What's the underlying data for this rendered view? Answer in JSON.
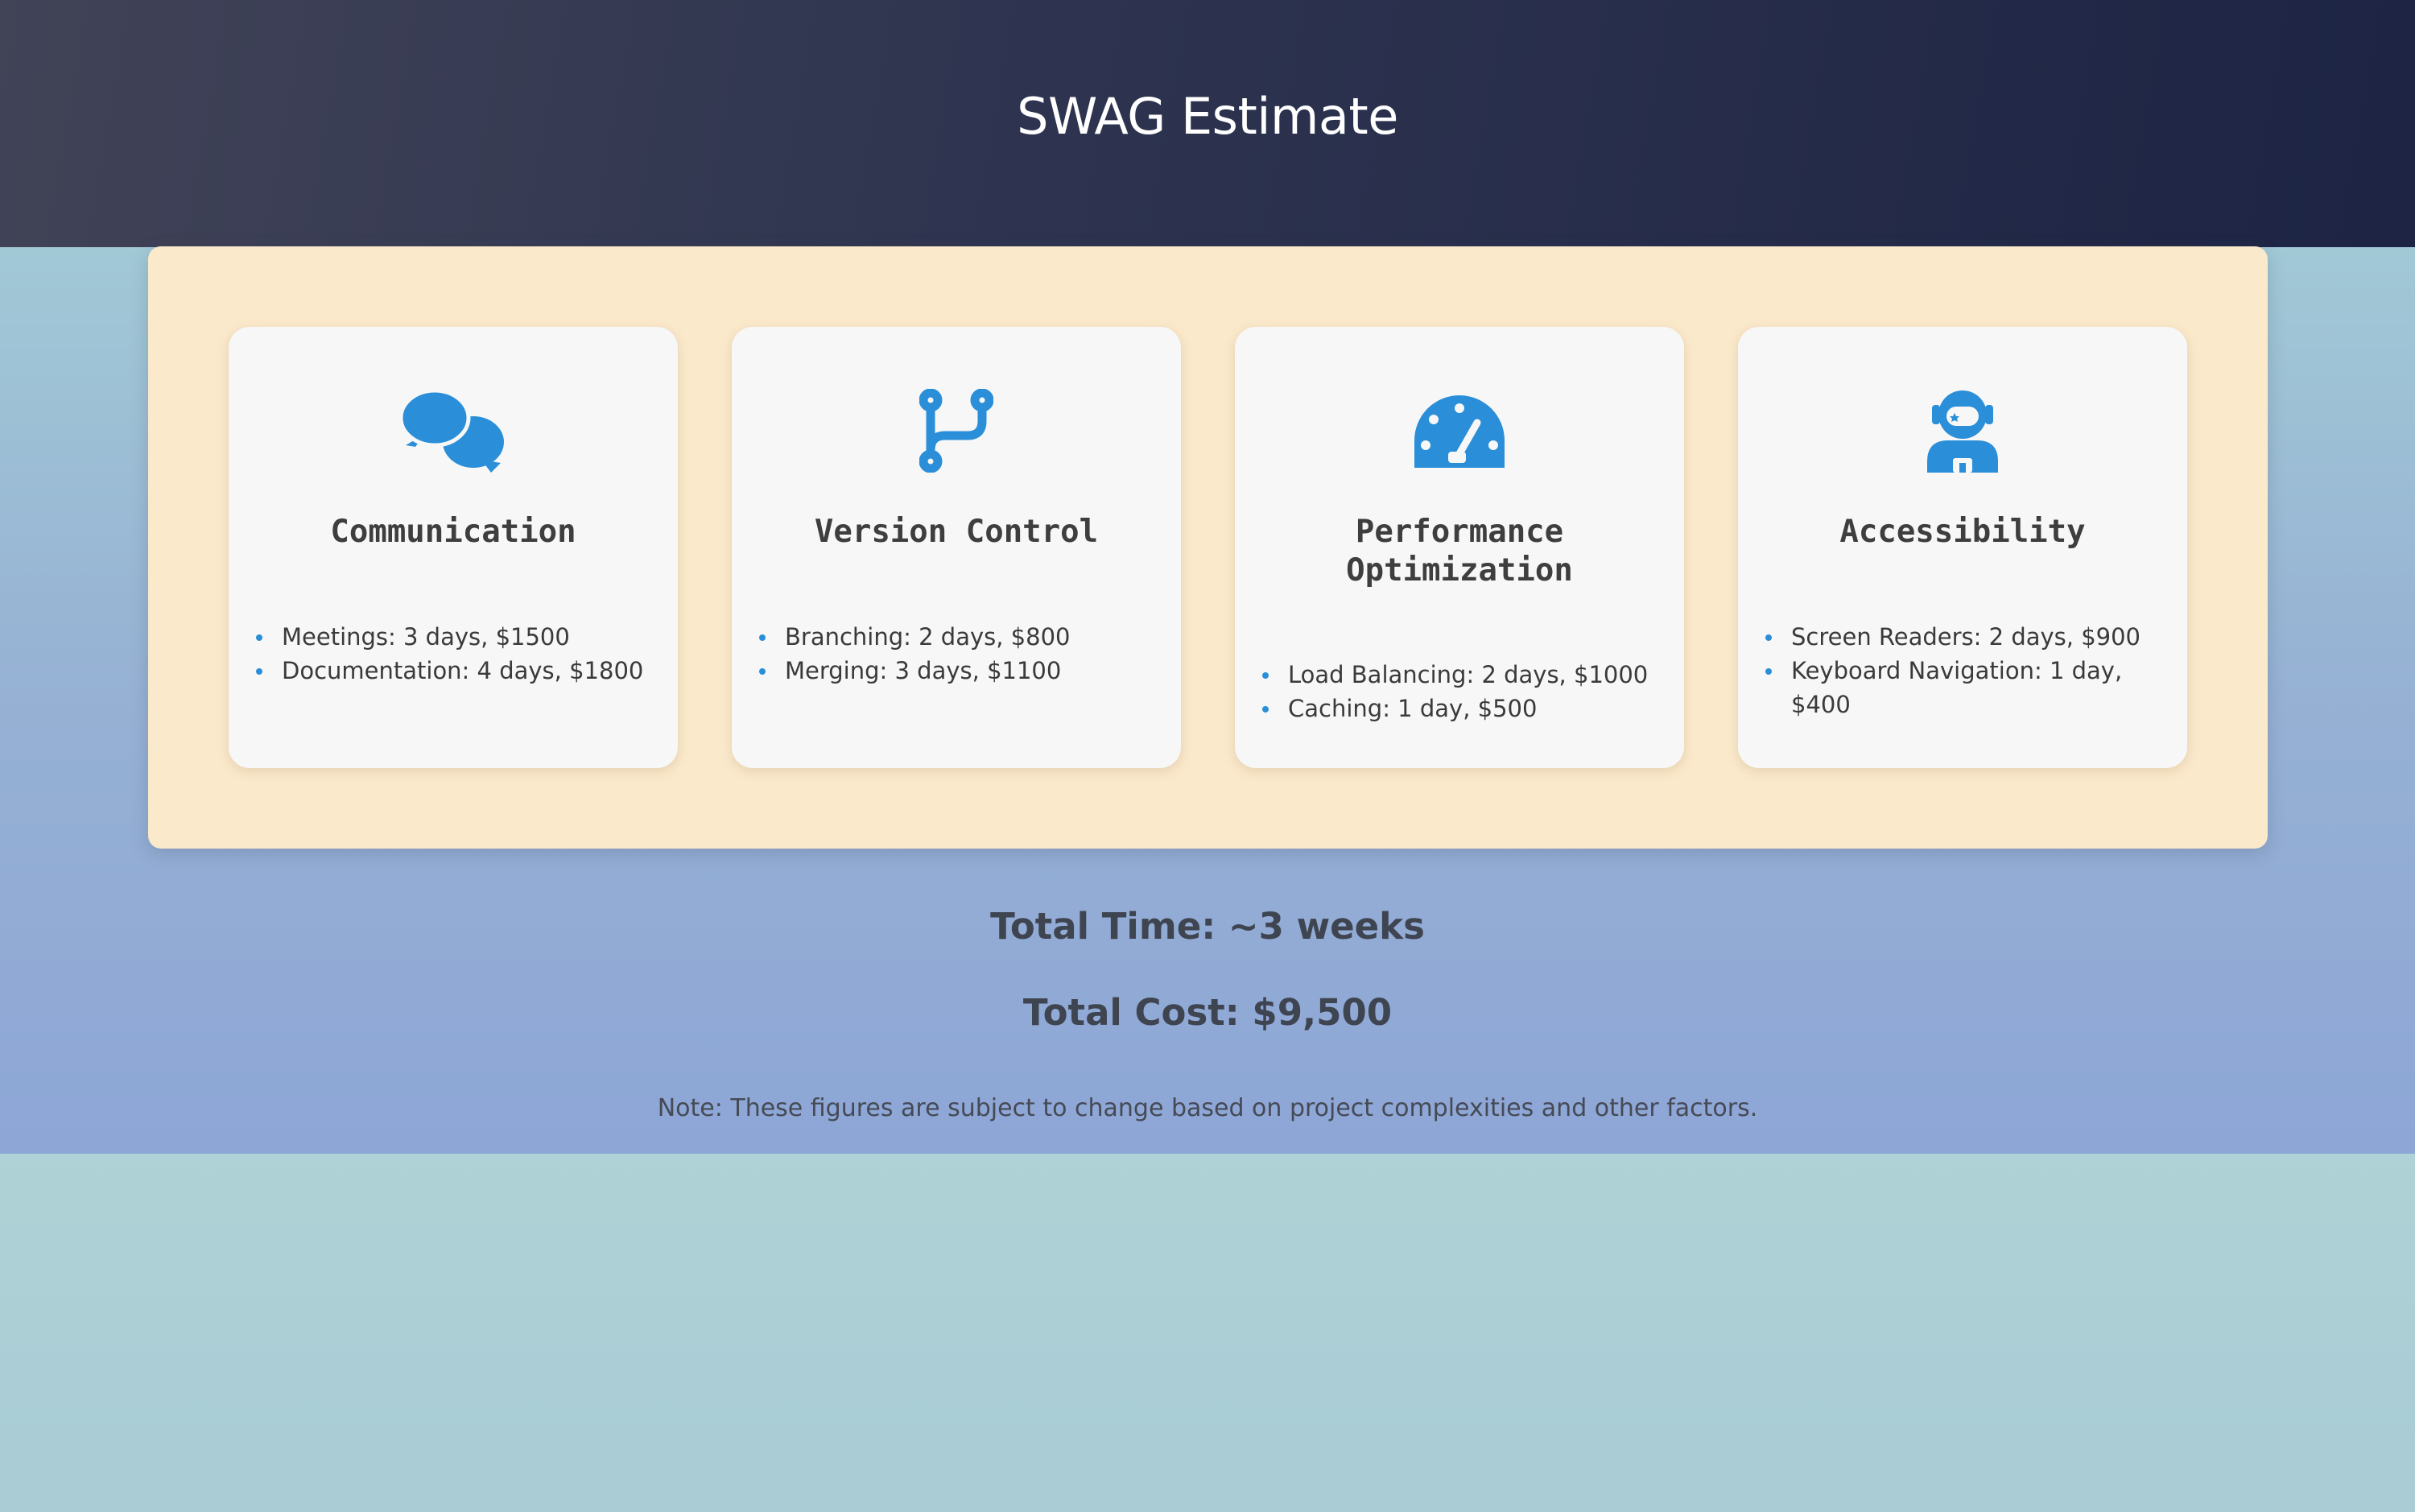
{
  "page": {
    "title": "SWAG Estimate"
  },
  "cards": [
    {
      "title": "Communication",
      "icon": "chat-bubbles-icon",
      "items": [
        "Meetings: 3 days, $1500",
        "Documentation: 4 days, $1800"
      ]
    },
    {
      "title": "Version Control",
      "icon": "code-branch-icon",
      "items": [
        "Branching: 2 days, $800",
        "Merging: 3 days, $1100"
      ]
    },
    {
      "title": "Performance Optimization",
      "icon": "gauge-icon",
      "items": [
        "Load Balancing: 2 days, $1000",
        "Caching: 1 day, $500"
      ]
    },
    {
      "title": "Accessibility",
      "icon": "user-astronaut-icon",
      "items": [
        "Screen Readers: 2 days, $900",
        "Keyboard Navigation: 1 day, $400"
      ]
    }
  ],
  "summary": {
    "total_time": "Total Time: ~3 weeks",
    "total_cost": "Total Cost: $9,500",
    "note": "Note: These figures are subject to change based on project complexities and other factors."
  },
  "colors": {
    "accent": "#2a8fd8",
    "panel": "#fbe9cb",
    "header": "#1d2444"
  }
}
